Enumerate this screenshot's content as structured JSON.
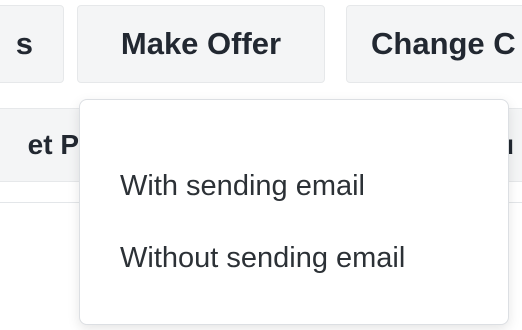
{
  "toolbar": {
    "partial_left_label": "s",
    "make_offer_label": "Make Offer",
    "change_label": "Change C"
  },
  "second_row": {
    "left_label": "et P",
    "right_label": "u"
  },
  "dropdown": {
    "items": [
      {
        "label": "With sending email"
      },
      {
        "label": "Without sending email"
      }
    ]
  }
}
